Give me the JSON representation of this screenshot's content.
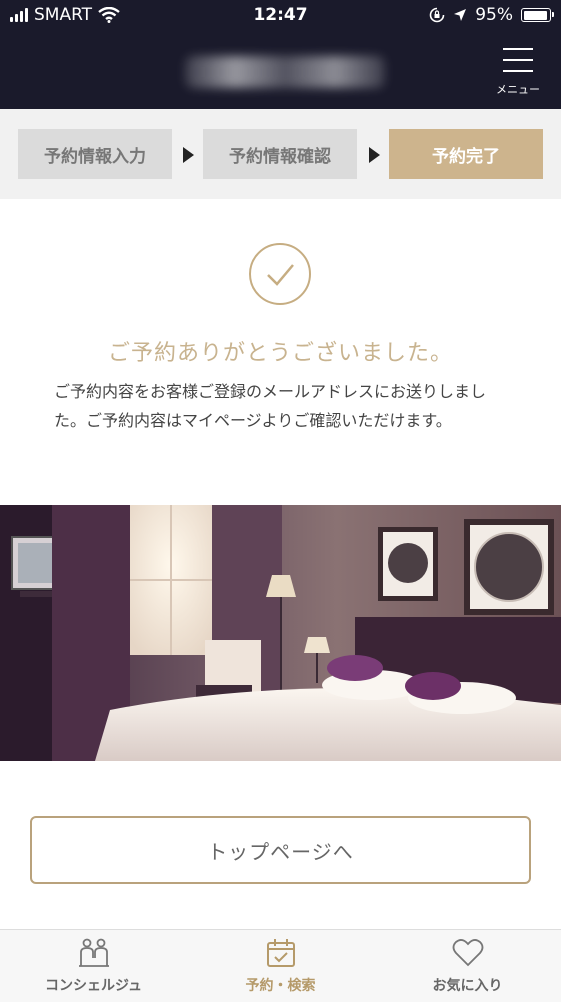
{
  "status_bar": {
    "carrier": "SMART",
    "time": "12:47",
    "battery": "95%",
    "battery_level": 0.95
  },
  "header": {
    "menu_label": "メニュー"
  },
  "steps": [
    {
      "label": "予約情報入力",
      "active": false
    },
    {
      "label": "予約情報確認",
      "active": false
    },
    {
      "label": "予約完了",
      "active": true
    }
  ],
  "main": {
    "thanks": "ご予約ありがとうございました。",
    "message": "ご予約内容をお客様ご登録のメールアドレスにお送りしました。ご予約内容はマイページよりご確認いただけます。",
    "top_button": "トップページへ"
  },
  "tabs": [
    {
      "label": "コンシェルジュ",
      "icon": "concierge-icon",
      "active": false
    },
    {
      "label": "予約・検索",
      "icon": "calendar-check-icon",
      "active": true
    },
    {
      "label": "お気に入り",
      "icon": "heart-icon",
      "active": false
    }
  ],
  "colors": {
    "header_bg": "#1a1a2b",
    "accent": "#cdb48d",
    "inactive_step": "#dbdbdb"
  }
}
